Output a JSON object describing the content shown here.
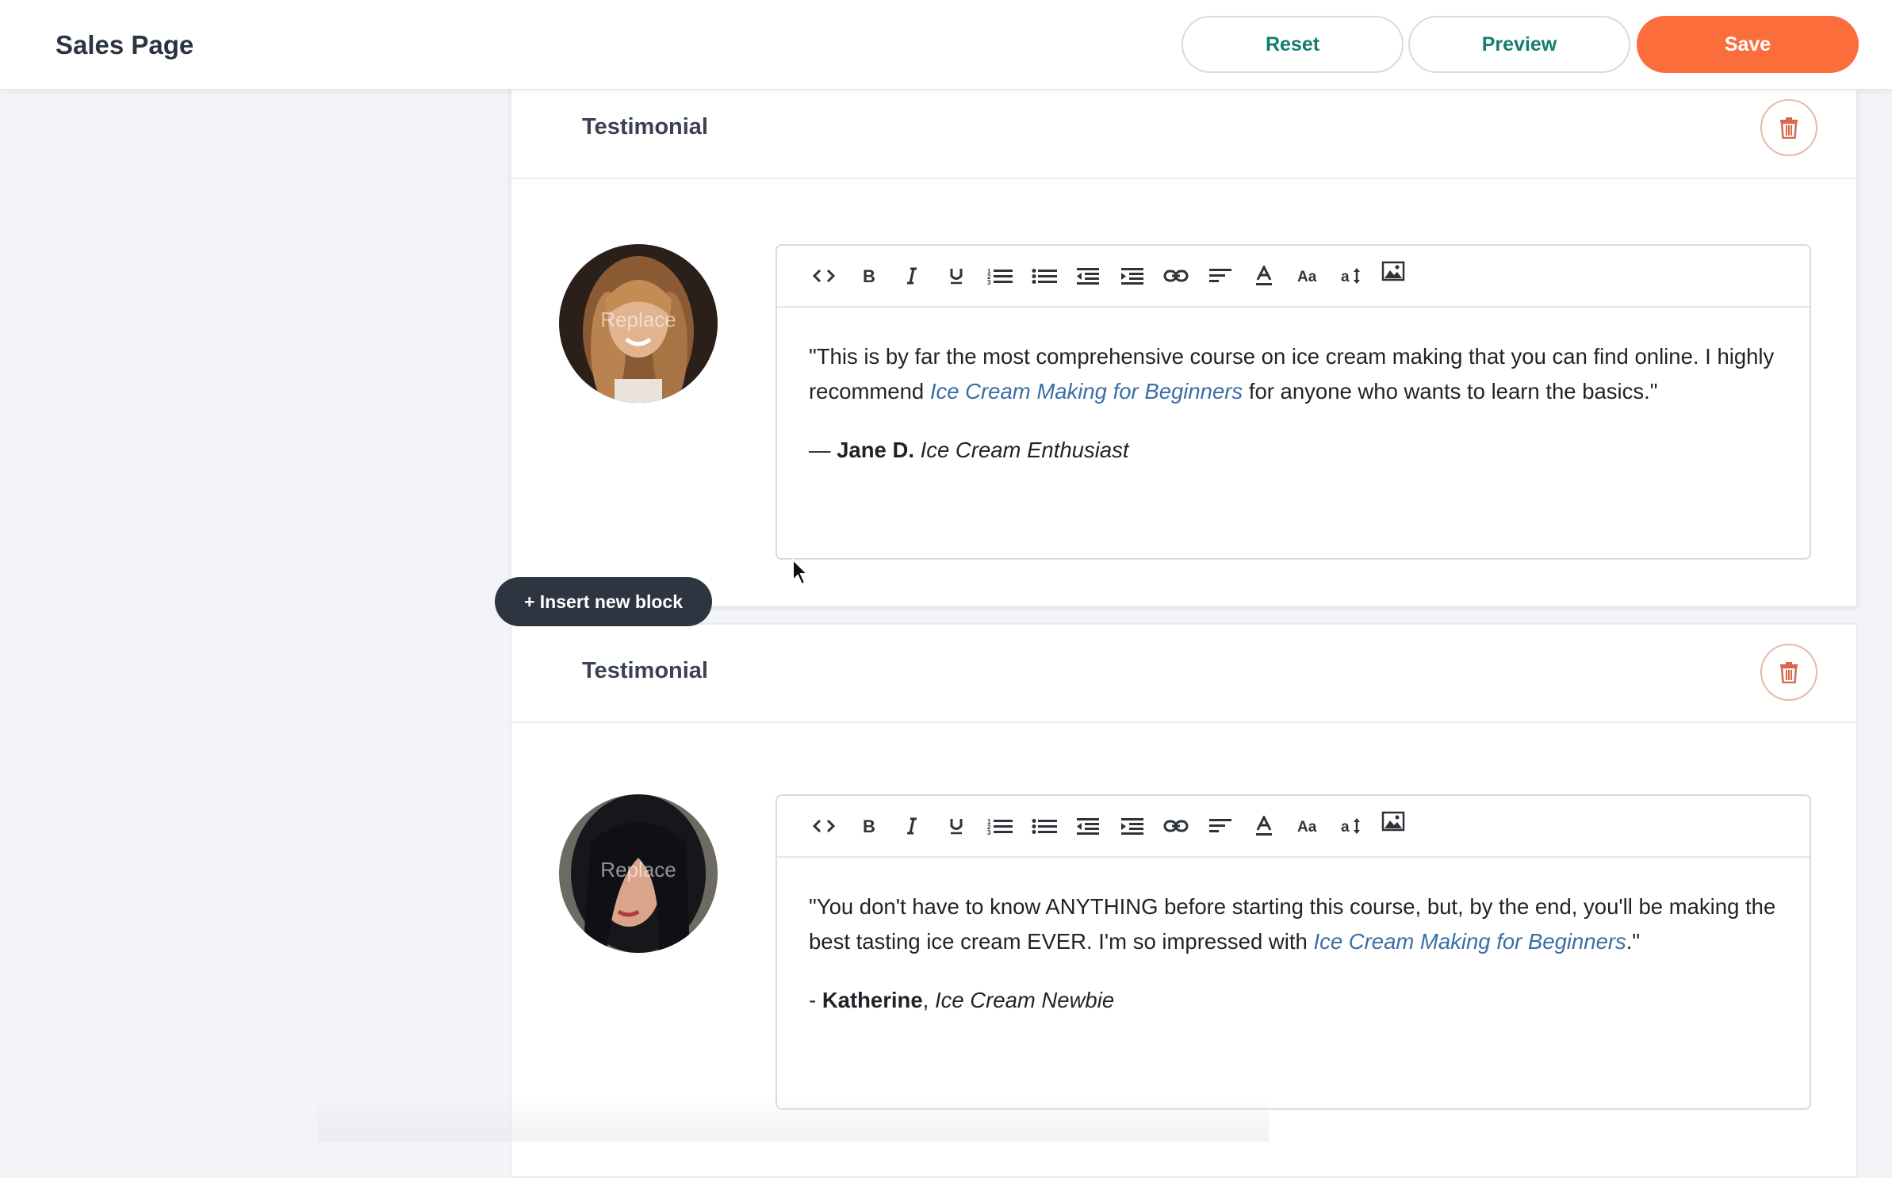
{
  "header": {
    "title": "Sales Page",
    "reset_label": "Reset",
    "preview_label": "Preview",
    "save_label": "Save"
  },
  "colors": {
    "accent_teal": "#147d6f",
    "save_orange": "#fb6d3a",
    "link_blue": "#3a6ea5",
    "insert_button_dark": "#2d3540"
  },
  "toolbar_icons": [
    "code-icon",
    "bold-icon",
    "italic-icon",
    "underline-icon",
    "ordered-list-icon",
    "unordered-list-icon",
    "outdent-icon",
    "indent-icon",
    "link-icon",
    "align-left-icon",
    "text-color-icon",
    "font-size-icon",
    "line-height-icon",
    "image-icon"
  ],
  "insert_block_label": "+ Insert new block",
  "blocks": [
    {
      "title": "Testimonial",
      "avatar_label": "Replace",
      "quote_before": "\"This is by far the most comprehensive course on ice cream making that you can find online. I highly recommend ",
      "quote_link": "Ice Cream Making for Beginners",
      "quote_after": " for anyone who wants to learn the basics.\"",
      "sig_prefix": "— ",
      "sig_name": "Jane D.",
      "sig_sep": " ",
      "sig_role": "Ice Cream Enthusiast"
    },
    {
      "title": "Testimonial",
      "avatar_label": "Replace",
      "quote_before": "\"You don't have to know ANYTHING before starting this course, but, by the end, you'll be making the best tasting ice cream EVER. I'm so impressed with ",
      "quote_link": "Ice Cream Making for Beginners",
      "quote_after": ".\"",
      "sig_prefix": "- ",
      "sig_name": "Katherine",
      "sig_sep": ", ",
      "sig_role": "Ice Cream Newbie"
    }
  ]
}
